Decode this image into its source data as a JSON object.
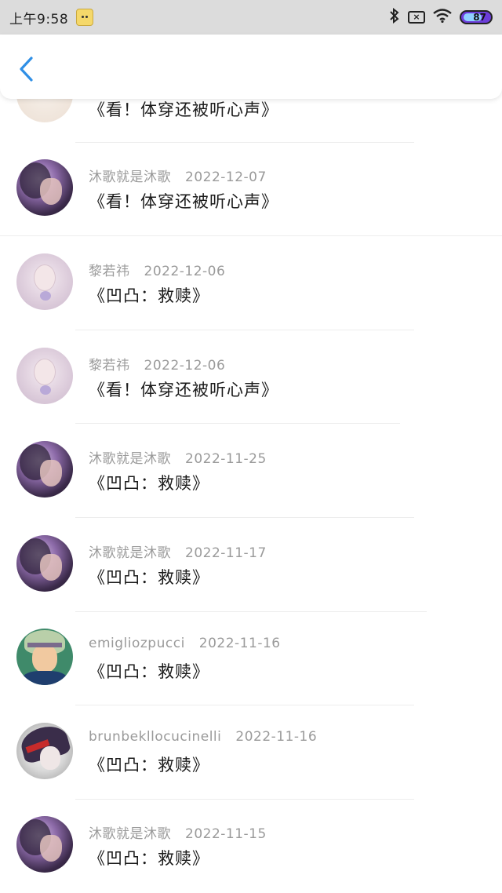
{
  "status_bar": {
    "time": "上午9:58",
    "battery": "87",
    "sim_label": "×"
  },
  "header": {
    "back_icon": "chevron-left-icon",
    "accent": "#2f8fe6"
  },
  "records": [
    {
      "avatar": "top",
      "user": "",
      "date": "",
      "book": "《看！体穿还被听心声》"
    },
    {
      "avatar": "muge",
      "user": "沐歌就是沐歌",
      "date": "2022-12-07",
      "book": "《看！体穿还被听心声》"
    },
    {
      "avatar": "li",
      "user": "黎若祎",
      "date": "2022-12-06",
      "book": "《凹凸：救赎》"
    },
    {
      "avatar": "li",
      "user": "黎若祎",
      "date": "2022-12-06",
      "book": "《看！体穿还被听心声》"
    },
    {
      "avatar": "muge",
      "user": "沐歌就是沐歌",
      "date": "2022-11-25",
      "book": "《凹凸：救赎》"
    },
    {
      "avatar": "muge",
      "user": "沐歌就是沐歌",
      "date": "2022-11-17",
      "book": "《凹凸：救赎》"
    },
    {
      "avatar": "emi",
      "user": "emigliozpucci",
      "date": "2022-11-16",
      "book": "《凹凸：救赎》"
    },
    {
      "avatar": "brun",
      "user": "brunbekllocucinelli",
      "date": "2022-11-16",
      "book": "《凹凸：救赎》"
    },
    {
      "avatar": "muge",
      "user": "沐歌就是沐歌",
      "date": "2022-11-15",
      "book": "《凹凸：救赎》"
    }
  ]
}
